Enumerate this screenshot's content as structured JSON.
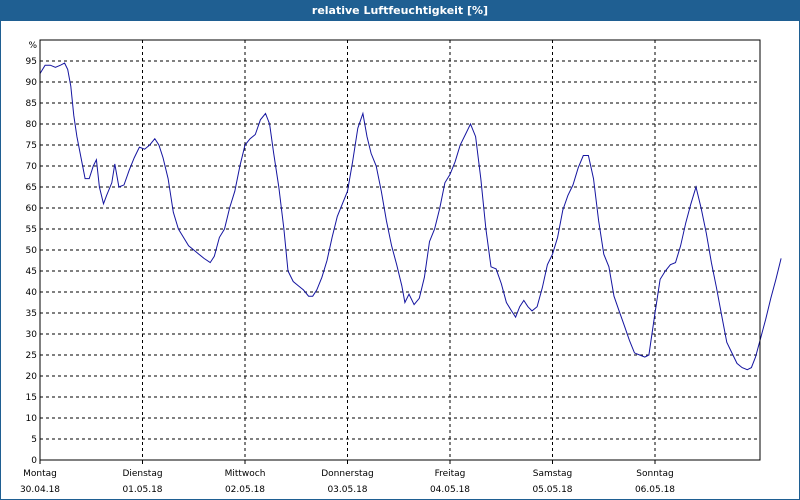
{
  "window": {
    "title": "relative Luftfeuchtigkeit [%]"
  },
  "colors": {
    "title_bar": "#1f5f92",
    "series_line": "#1515a0",
    "grid": "#000000"
  },
  "chart_data": {
    "type": "line",
    "title": "relative Luftfeuchtigkeit [%]",
    "unit_label": "%",
    "ylim": [
      0,
      100
    ],
    "yticks": [
      0,
      5,
      10,
      15,
      20,
      25,
      30,
      35,
      40,
      45,
      50,
      55,
      60,
      65,
      70,
      75,
      80,
      85,
      90,
      95
    ],
    "xlim": [
      0,
      7
    ],
    "xtick_labels": [
      {
        "day": "Montag",
        "date": "30.04.18"
      },
      {
        "day": "Dienstag",
        "date": "01.05.18"
      },
      {
        "day": "Mittwoch",
        "date": "02.05.18"
      },
      {
        "day": "Donnerstag",
        "date": "03.05.18"
      },
      {
        "day": "Freitag",
        "date": "04.05.18"
      },
      {
        "day": "Samstag",
        "date": "05.05.18"
      },
      {
        "day": "Sonntag",
        "date": "06.05.18"
      }
    ],
    "grid": true,
    "legend": false,
    "series": [
      {
        "points": [
          [
            0.0,
            92
          ],
          [
            0.05,
            94
          ],
          [
            0.1,
            94
          ],
          [
            0.15,
            93.5
          ],
          [
            0.2,
            94
          ],
          [
            0.24,
            94.5
          ],
          [
            0.27,
            93
          ],
          [
            0.3,
            89
          ],
          [
            0.33,
            82
          ],
          [
            0.36,
            77
          ],
          [
            0.4,
            72
          ],
          [
            0.44,
            67
          ],
          [
            0.48,
            67
          ],
          [
            0.52,
            70
          ],
          [
            0.55,
            71.5
          ],
          [
            0.58,
            65
          ],
          [
            0.62,
            61
          ],
          [
            0.65,
            63
          ],
          [
            0.7,
            66
          ],
          [
            0.73,
            70.5
          ],
          [
            0.77,
            65
          ],
          [
            0.82,
            65.5
          ],
          [
            0.87,
            69
          ],
          [
            0.92,
            72
          ],
          [
            0.97,
            74.5
          ],
          [
            1.02,
            74
          ],
          [
            1.07,
            75
          ],
          [
            1.12,
            76.5
          ],
          [
            1.16,
            75
          ],
          [
            1.2,
            72
          ],
          [
            1.25,
            67
          ],
          [
            1.3,
            59
          ],
          [
            1.35,
            55
          ],
          [
            1.4,
            53
          ],
          [
            1.45,
            51
          ],
          [
            1.5,
            50
          ],
          [
            1.55,
            49
          ],
          [
            1.6,
            48
          ],
          [
            1.66,
            47
          ],
          [
            1.7,
            48.5
          ],
          [
            1.75,
            53
          ],
          [
            1.8,
            55
          ],
          [
            1.85,
            60
          ],
          [
            1.9,
            64
          ],
          [
            1.95,
            70
          ],
          [
            2.0,
            75
          ],
          [
            2.05,
            76.5
          ],
          [
            2.1,
            77.5
          ],
          [
            2.15,
            81
          ],
          [
            2.2,
            82.5
          ],
          [
            2.24,
            80
          ],
          [
            2.28,
            73
          ],
          [
            2.33,
            65
          ],
          [
            2.38,
            55
          ],
          [
            2.42,
            45
          ],
          [
            2.47,
            42.5
          ],
          [
            2.52,
            41.5
          ],
          [
            2.57,
            40.5
          ],
          [
            2.62,
            39
          ],
          [
            2.66,
            39
          ],
          [
            2.7,
            40.5
          ],
          [
            2.75,
            43.5
          ],
          [
            2.8,
            47.5
          ],
          [
            2.85,
            53
          ],
          [
            2.9,
            58
          ],
          [
            2.95,
            61
          ],
          [
            3.0,
            64
          ],
          [
            3.05,
            71
          ],
          [
            3.1,
            79
          ],
          [
            3.15,
            82.5
          ],
          [
            3.19,
            77
          ],
          [
            3.23,
            73
          ],
          [
            3.28,
            70
          ],
          [
            3.33,
            64
          ],
          [
            3.38,
            57
          ],
          [
            3.43,
            51
          ],
          [
            3.48,
            46.5
          ],
          [
            3.53,
            41.5
          ],
          [
            3.56,
            37.5
          ],
          [
            3.6,
            39.5
          ],
          [
            3.65,
            37
          ],
          [
            3.7,
            38.5
          ],
          [
            3.75,
            43.5
          ],
          [
            3.8,
            52
          ],
          [
            3.85,
            55
          ],
          [
            3.9,
            60
          ],
          [
            3.95,
            66
          ],
          [
            4.0,
            68
          ],
          [
            4.05,
            71
          ],
          [
            4.1,
            75
          ],
          [
            4.15,
            77.5
          ],
          [
            4.2,
            80
          ],
          [
            4.25,
            77
          ],
          [
            4.3,
            67
          ],
          [
            4.35,
            55
          ],
          [
            4.4,
            46
          ],
          [
            4.45,
            45.5
          ],
          [
            4.5,
            42
          ],
          [
            4.55,
            37.5
          ],
          [
            4.6,
            35.5
          ],
          [
            4.64,
            34
          ],
          [
            4.68,
            36.5
          ],
          [
            4.72,
            38
          ],
          [
            4.76,
            36.5
          ],
          [
            4.8,
            35.5
          ],
          [
            4.85,
            36.5
          ],
          [
            4.9,
            41
          ],
          [
            4.95,
            46.5
          ],
          [
            5.0,
            49
          ],
          [
            5.05,
            53
          ],
          [
            5.1,
            59.5
          ],
          [
            5.15,
            63
          ],
          [
            5.2,
            65.5
          ],
          [
            5.25,
            69.5
          ],
          [
            5.3,
            72.5
          ],
          [
            5.35,
            72.5
          ],
          [
            5.4,
            67
          ],
          [
            5.45,
            57
          ],
          [
            5.5,
            49
          ],
          [
            5.55,
            46
          ],
          [
            5.6,
            39
          ],
          [
            5.65,
            35.5
          ],
          [
            5.7,
            32
          ],
          [
            5.75,
            28.5
          ],
          [
            5.8,
            25.5
          ],
          [
            5.85,
            25
          ],
          [
            5.9,
            24.5
          ],
          [
            5.94,
            25
          ],
          [
            6.0,
            35
          ],
          [
            6.05,
            43
          ],
          [
            6.1,
            45
          ],
          [
            6.15,
            46.5
          ],
          [
            6.2,
            47
          ],
          [
            6.25,
            51
          ],
          [
            6.3,
            56.5
          ],
          [
            6.35,
            61
          ],
          [
            6.4,
            65
          ],
          [
            6.45,
            60
          ],
          [
            6.5,
            54
          ],
          [
            6.55,
            47
          ],
          [
            6.6,
            41
          ],
          [
            6.65,
            34.5
          ],
          [
            6.7,
            28
          ],
          [
            6.75,
            25.5
          ],
          [
            6.8,
            23
          ],
          [
            6.85,
            22
          ],
          [
            6.9,
            21.5
          ],
          [
            6.94,
            22
          ],
          [
            6.98,
            24.5
          ],
          [
            7.03,
            29
          ],
          [
            7.08,
            33.5
          ],
          [
            7.13,
            38.5
          ],
          [
            7.18,
            43
          ],
          [
            7.23,
            48
          ]
        ]
      }
    ]
  }
}
